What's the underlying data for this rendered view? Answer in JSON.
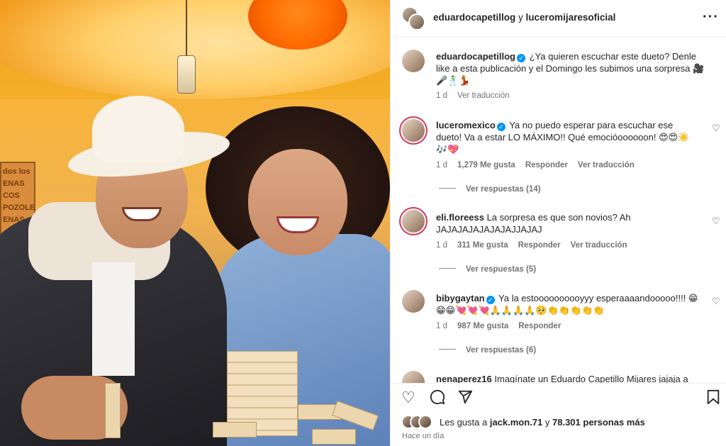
{
  "header": {
    "user1": "eduardocapetillog",
    "joiner": " y ",
    "user2": "luceromijaresoficial",
    "more_icon": "more-horizontal-icon"
  },
  "photo": {
    "sign_lines": [
      "dos los",
      "ENAS",
      "COS",
      "POZOLE",
      "ENAS"
    ]
  },
  "caption": {
    "username": "eduardocapetillog",
    "text": "¿Ya quieren escuchar este dueto? Denle like a esta publicación y el Domingo les subimos una sorpresa 🎥🎤🕺💃",
    "age": "1 d",
    "translate": "Ver traducción"
  },
  "comments": [
    {
      "username": "luceromexico",
      "verified": true,
      "text": "Ya no puedo esperar para escuchar ese dueto! Va a estar LO MÁXIMO!! Qué emocióoooooon! 😍😍☀️🎶💖",
      "age": "1 d",
      "likes": "1,279 Me gusta",
      "reply": "Responder",
      "translate": "Ver traducción",
      "replies": "Ver respuestas (14)"
    },
    {
      "username": "eli.floreess",
      "verified": false,
      "text": "La sorpresa es que son novios? Ah JAJAJAJAJAJAJAJJAJAJ",
      "age": "1 d",
      "likes": "311 Me gusta",
      "reply": "Responder",
      "translate": "Ver traducción",
      "replies": "Ver respuestas (5)"
    },
    {
      "username": "bibygaytan",
      "verified": true,
      "text": "Ya la estoooooooooyyy esperaaaandooooo!!!! 😁😁😁💘💘💘🙏🙏🙏🙏🥺👏👏👏👏👏",
      "age": "1 d",
      "likes": "987 Me gusta",
      "reply": "Responder",
      "replies": "Ver respuestas (6)"
    },
    {
      "username": "nenaperez16",
      "text": "Imagínate un Eduardo Capetillo Mijares jajaja a"
    }
  ],
  "actions": {
    "like_icon": "heart-icon",
    "comment_icon": "comment-icon",
    "share_icon": "send-icon",
    "save_icon": "bookmark-icon"
  },
  "likes": {
    "prefix": "Les gusta a ",
    "user": "jack.mon.71",
    "middle": " y ",
    "count": "78.301 personas más"
  },
  "timestamp": "Hace un día",
  "colors": {
    "verified": "#0095f6",
    "story_ring": "#d3375d",
    "meta_text": "#737373"
  }
}
